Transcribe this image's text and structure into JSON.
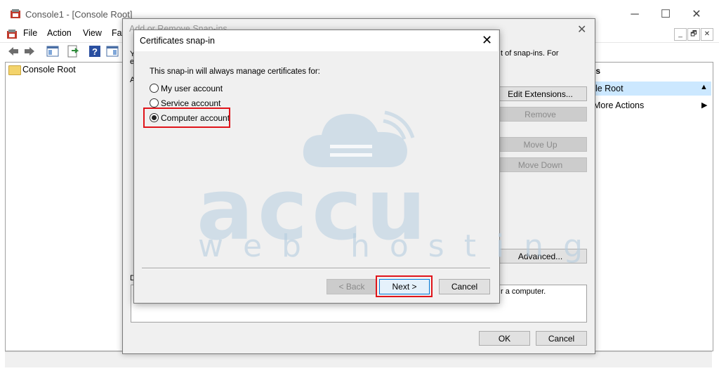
{
  "main_window": {
    "title": "Console1 - [Console Root]",
    "controls": {
      "minimize": "─",
      "maximize": "☐",
      "close": "✕"
    },
    "menu": [
      "File",
      "Action",
      "View",
      "Fav"
    ],
    "mdi_controls": [
      "_",
      "🗗",
      "✕"
    ],
    "tree": {
      "root": "Console Root"
    },
    "actions_pane": {
      "header": "ns",
      "selected": "ole Root",
      "more": "More Actions"
    }
  },
  "add_remove_dialog": {
    "title": "Add or Remove Snap-ins",
    "partial_left_1": "Y",
    "partial_left_2": "e",
    "partial_left_3": "A",
    "partial_left_4": "D",
    "intro_fragment": "t of snap-ins. For",
    "buttons": {
      "edit_extensions": "Edit Extensions...",
      "remove": "Remove",
      "move_up": "Move Up",
      "move_down": "Move Down",
      "advanced": "Advanced...",
      "ok": "OK",
      "cancel": "Cancel"
    },
    "description_fragment": "r a computer."
  },
  "cert_dialog": {
    "title": "Certificates snap-in",
    "close": "✕",
    "prompt": "This snap-in will always manage certificates for:",
    "options": [
      {
        "label": "My user account",
        "checked": false
      },
      {
        "label": "Service account",
        "checked": false
      },
      {
        "label": "Computer account",
        "checked": true
      }
    ],
    "buttons": {
      "back": "< Back",
      "next": "Next >",
      "cancel": "Cancel"
    }
  },
  "watermark": {
    "word": "accu",
    "sub": "web hosting"
  },
  "colors": {
    "highlight": "#e0141a",
    "selection": "#cce8ff",
    "watermark": "#b7cee0"
  }
}
